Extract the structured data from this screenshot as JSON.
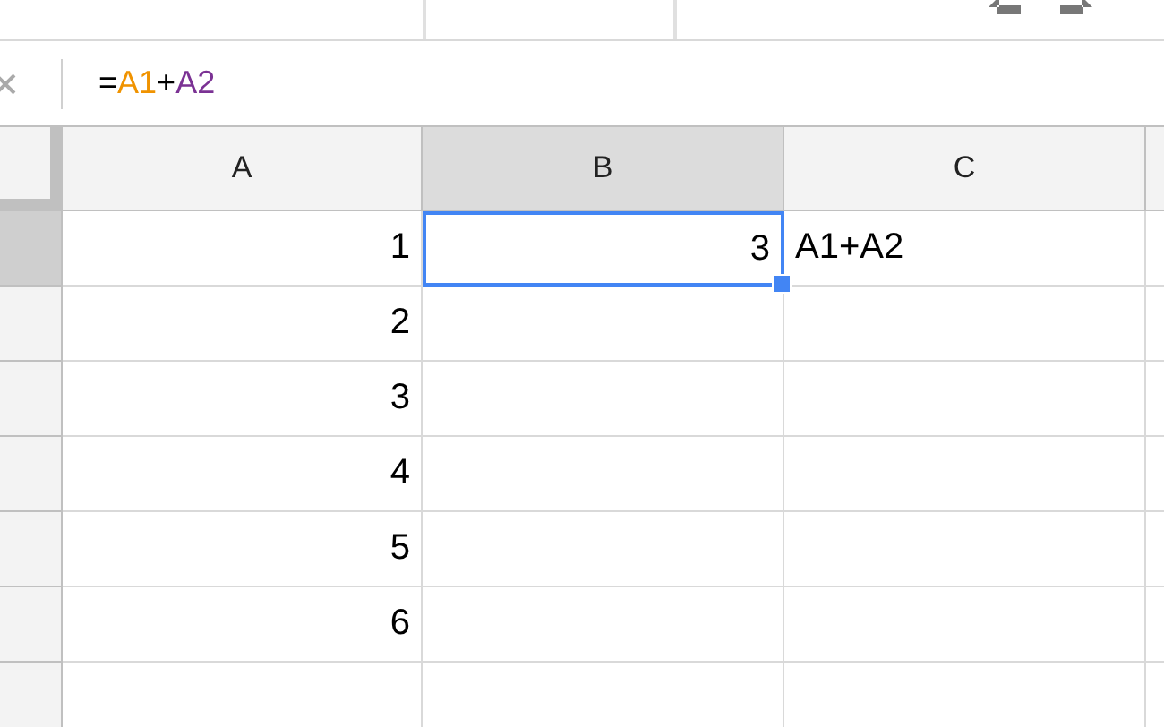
{
  "formula_bar": {
    "parts": [
      {
        "text": "=",
        "kind": "plain"
      },
      {
        "text": "A1",
        "kind": "ref",
        "color": "#f09300"
      },
      {
        "text": "+",
        "kind": "plain"
      },
      {
        "text": "A2",
        "kind": "ref",
        "color": "#7b3294"
      }
    ]
  },
  "columns": [
    {
      "label": "A",
      "selected": false
    },
    {
      "label": "B",
      "selected": true
    },
    {
      "label": "C",
      "selected": false
    }
  ],
  "rows": [
    {
      "selected": true,
      "cells": [
        {
          "text": "1",
          "selected": false
        },
        {
          "text": "3",
          "selected": true
        },
        {
          "text": "A1+A2",
          "selected": false
        }
      ]
    },
    {
      "selected": false,
      "cells": [
        {
          "text": "2",
          "selected": false
        },
        {
          "text": "",
          "selected": false
        },
        {
          "text": "",
          "selected": false
        }
      ]
    },
    {
      "selected": false,
      "cells": [
        {
          "text": "3",
          "selected": false
        },
        {
          "text": "",
          "selected": false
        },
        {
          "text": "",
          "selected": false
        }
      ]
    },
    {
      "selected": false,
      "cells": [
        {
          "text": "4",
          "selected": false
        },
        {
          "text": "",
          "selected": false
        },
        {
          "text": "",
          "selected": false
        }
      ]
    },
    {
      "selected": false,
      "cells": [
        {
          "text": "5",
          "selected": false
        },
        {
          "text": "",
          "selected": false
        },
        {
          "text": "",
          "selected": false
        }
      ]
    },
    {
      "selected": false,
      "cells": [
        {
          "text": "6",
          "selected": false
        },
        {
          "text": "",
          "selected": false
        },
        {
          "text": "",
          "selected": false
        }
      ]
    },
    {
      "selected": false,
      "cells": [
        {
          "text": "",
          "selected": false
        },
        {
          "text": "",
          "selected": false
        },
        {
          "text": "",
          "selected": false
        }
      ]
    }
  ]
}
